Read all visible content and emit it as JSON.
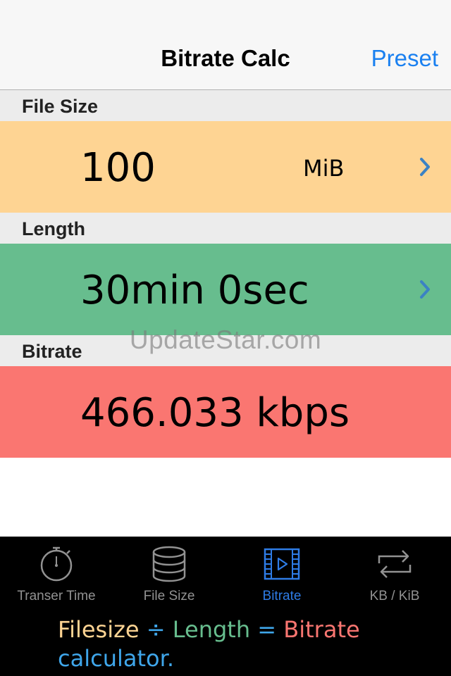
{
  "nav": {
    "title": "Bitrate Calc",
    "preset_label": "Preset"
  },
  "sections": {
    "file_size": {
      "header": "File Size",
      "value": "100",
      "unit": "MiB",
      "color": "#fed493"
    },
    "length": {
      "header": "Length",
      "value": "30min 0sec",
      "color": "#67bd8e"
    },
    "bitrate": {
      "header": "Bitrate",
      "value": "466.033 kbps",
      "color": "#fa7671"
    }
  },
  "watermark": "UpdateStar.com",
  "tabs": [
    {
      "label": "Transer Time",
      "icon": "stopwatch-icon",
      "active": false
    },
    {
      "label": "File Size",
      "icon": "database-icon",
      "active": false
    },
    {
      "label": "Bitrate",
      "icon": "film-play-icon",
      "active": true
    },
    {
      "label": "KB / KiB",
      "icon": "swap-arrows-icon",
      "active": false
    }
  ],
  "formula": {
    "filesize": "Filesize",
    "divide": " ÷ ",
    "length": "Length",
    "equals": " = ",
    "bitrate": "Bitrate",
    "calculator": "calculator.",
    "colors": {
      "filesize": "#fed493",
      "operator": "#3fa6ea",
      "length": "#67bd8e",
      "bitrate": "#fa7671",
      "calculator": "#3fa6ea"
    }
  },
  "colors": {
    "accent": "#1a80f0",
    "tab_active": "#2e7ce6",
    "tab_inactive": "#929292"
  }
}
